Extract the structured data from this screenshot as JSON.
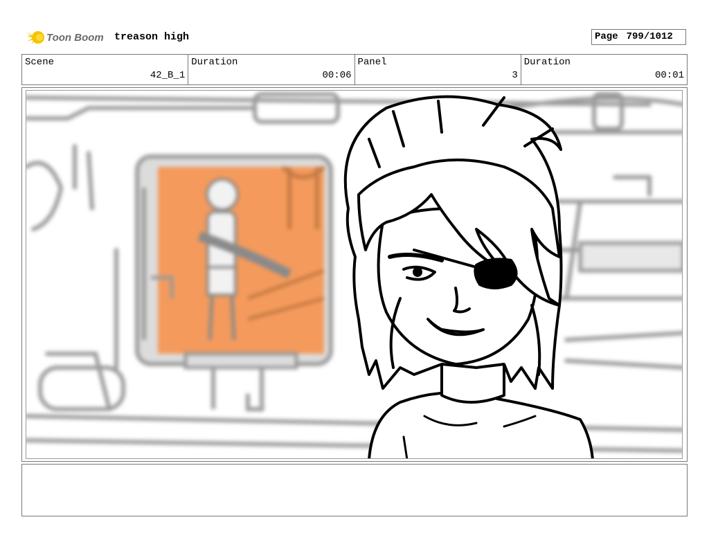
{
  "header": {
    "logo_text": "Toon Boom",
    "project_title": "treason high",
    "page_label": "Page",
    "page_value": "799/1012"
  },
  "info": {
    "scene_label": "Scene",
    "scene_value": "42_B_1",
    "duration1_label": "Duration",
    "duration1_value": "00:06",
    "panel_label": "Panel",
    "panel_value": "3",
    "duration2_label": "Duration",
    "duration2_value": "00:01"
  },
  "colors": {
    "accent_orange": "#f49a5c",
    "logo_yellow": "#f5c400",
    "logo_gray": "#6a6a6a"
  },
  "notes": {
    "text": ""
  }
}
